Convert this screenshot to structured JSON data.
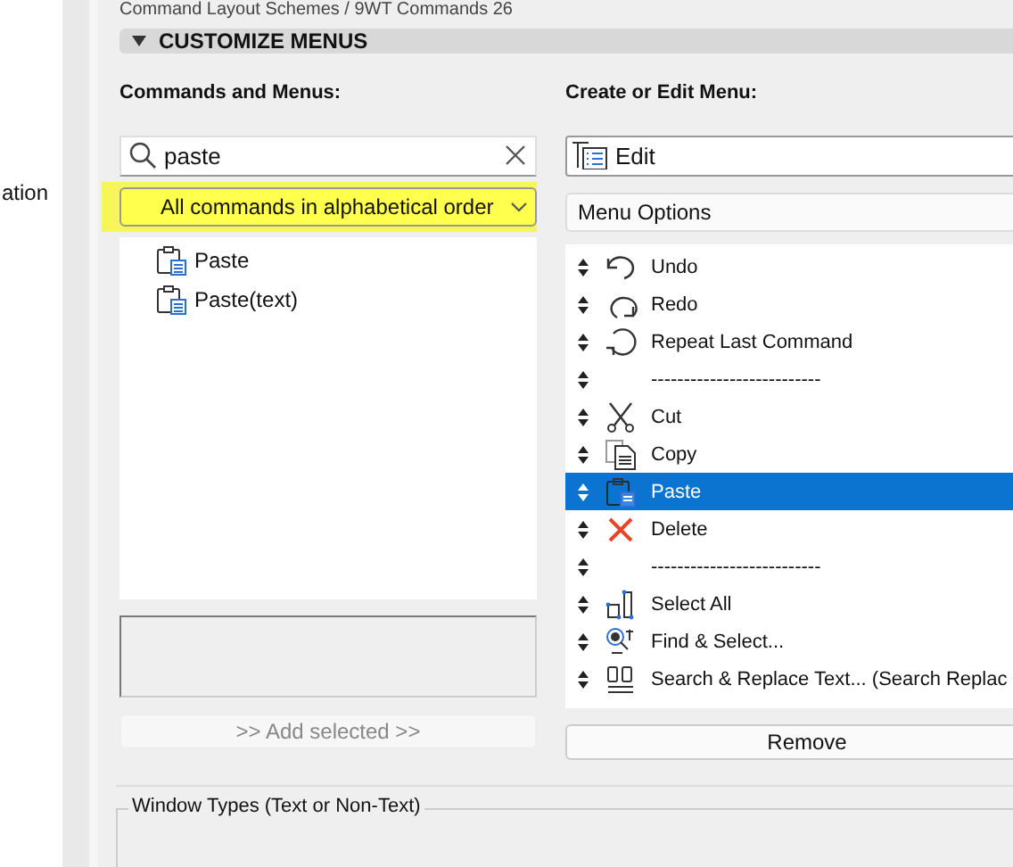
{
  "breadcrumb": "Command Layout Schemes / 9WT Commands 26",
  "sidebar": {
    "text": "ation"
  },
  "section": {
    "title": "CUSTOMIZE MENUS",
    "expanded": true
  },
  "commands": {
    "label": "Commands and Menus:",
    "search": {
      "value": "paste"
    },
    "filter": {
      "value": "All commands in alphabetical order",
      "highlighted": true
    },
    "items": [
      {
        "label": "Paste"
      },
      {
        "label": "Paste(text)"
      }
    ],
    "add_button": {
      "label": ">> Add selected >>",
      "disabled": true
    }
  },
  "menu": {
    "label": "Create or Edit Menu:",
    "name": {
      "value": "Edit"
    },
    "options": {
      "value": "Menu Options"
    },
    "items": [
      {
        "kind": "command",
        "label": "Undo",
        "selected": false
      },
      {
        "kind": "command",
        "label": "Redo",
        "selected": false
      },
      {
        "kind": "command",
        "label": "Repeat Last Command",
        "selected": false
      },
      {
        "kind": "separator",
        "label": "--------------------------",
        "selected": false
      },
      {
        "kind": "command",
        "label": "Cut",
        "selected": false
      },
      {
        "kind": "command",
        "label": "Copy",
        "selected": false
      },
      {
        "kind": "command",
        "label": "Paste",
        "selected": true
      },
      {
        "kind": "command",
        "label": "Delete",
        "selected": false
      },
      {
        "kind": "separator",
        "label": "--------------------------",
        "selected": false
      },
      {
        "kind": "command",
        "label": "Select All",
        "selected": false
      },
      {
        "kind": "command",
        "label": "Find & Select...",
        "selected": false
      },
      {
        "kind": "command",
        "label": "Search & Replace Text... (Search  Replac",
        "selected": false
      }
    ],
    "remove_button": {
      "label": "Remove",
      "disabled": false
    }
  },
  "window_types": {
    "title": "Window Types (Text or Non-Text)"
  }
}
